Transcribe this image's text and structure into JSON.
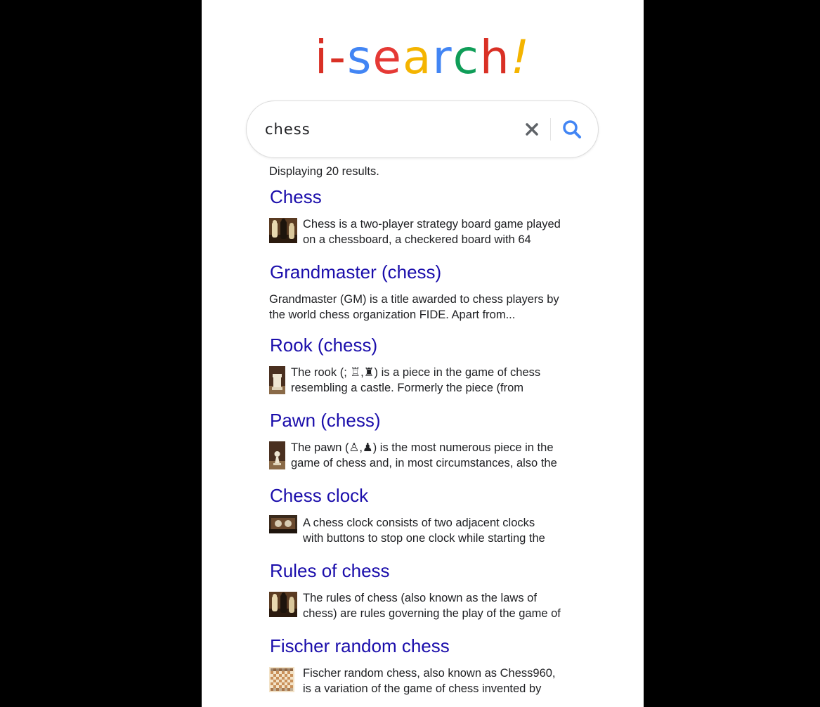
{
  "logo": {
    "letters": [
      {
        "char": "i",
        "color": "#d93025"
      },
      {
        "char": "-",
        "color": "#d93025"
      },
      {
        "char": "s",
        "color": "#4285f4"
      },
      {
        "char": "e",
        "color": "#e53935"
      },
      {
        "char": "a",
        "color": "#f4b400"
      },
      {
        "char": "r",
        "color": "#4285f4"
      },
      {
        "char": "c",
        "color": "#0f9d58"
      },
      {
        "char": "h",
        "color": "#d93025"
      },
      {
        "char": "!",
        "color": "#f4b400"
      }
    ]
  },
  "search": {
    "value": "chess",
    "clear_icon": "close-icon",
    "search_icon": "search-icon",
    "icon_color_clear": "#5f6368",
    "icon_color_search": "#4285f4"
  },
  "results_summary": "Displaying 20 results.",
  "colors": {
    "link": "#1a0dab",
    "text": "#202124"
  },
  "results": [
    {
      "title": "Chess",
      "snippet_line1": "Chess is a two-player strategy board game played",
      "snippet_line2": "on a chessboard, a checkered board with 64",
      "thumbnail": "chess-pieces-thumbnail"
    },
    {
      "title": "Grandmaster (chess)",
      "snippet_line1": "Grandmaster (GM) is a title awarded to chess players by",
      "snippet_line2": "the world chess organization FIDE. Apart from...",
      "thumbnail": null
    },
    {
      "title": "Rook (chess)",
      "snippet_line1": "The rook (; ♖,♜) is a piece in the game of chess",
      "snippet_line2": "resembling a castle. Formerly the piece (from",
      "thumbnail": "rook-thumbnail"
    },
    {
      "title": "Pawn (chess)",
      "snippet_line1": "The pawn (♙,♟) is the most numerous piece in the",
      "snippet_line2": "game of chess and, in most circumstances, also the",
      "thumbnail": "pawn-thumbnail"
    },
    {
      "title": "Chess clock",
      "snippet_line1": "A chess clock consists of two adjacent clocks",
      "snippet_line2": "with buttons to stop one clock while starting the",
      "thumbnail": "chess-clock-thumbnail"
    },
    {
      "title": "Rules of chess",
      "snippet_line1": "The rules of chess (also known as the laws of",
      "snippet_line2": "chess) are rules governing the play of the game of",
      "thumbnail": "chess-pieces-thumbnail"
    },
    {
      "title": "Fischer random chess",
      "snippet_line1": "Fischer random chess, also known as Chess960,",
      "snippet_line2": "is a variation of the game of chess invented by",
      "thumbnail": "chessboard-thumbnail"
    }
  ]
}
